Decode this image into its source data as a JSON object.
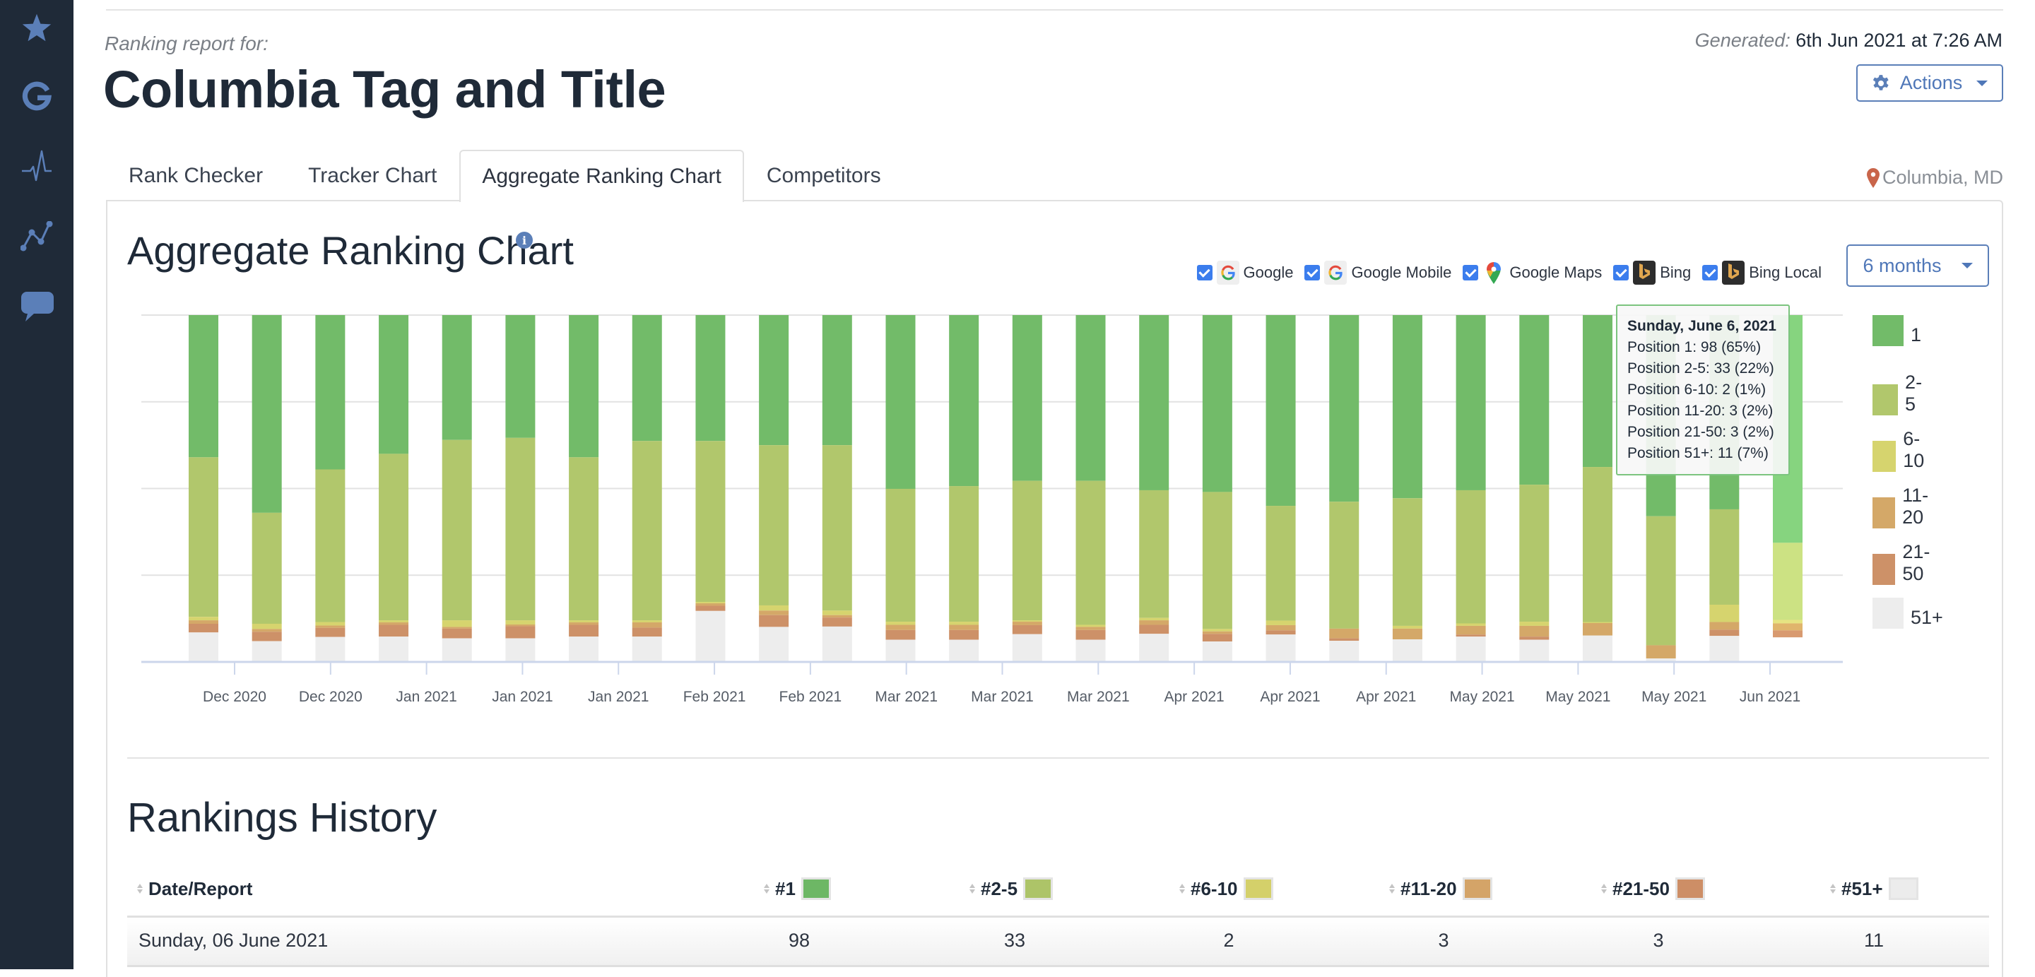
{
  "sidebar": {
    "items": [
      {
        "icon": "star-icon"
      },
      {
        "icon": "google-icon"
      },
      {
        "icon": "pulse-icon"
      },
      {
        "icon": "line-chart-icon"
      },
      {
        "icon": "chat-icon"
      }
    ]
  },
  "header": {
    "report_for": "Ranking report for:",
    "title": "Columbia Tag and Title",
    "generated_label": "Generated:",
    "generated_value": "6th Jun 2021 at 7:26 AM",
    "actions_label": "Actions",
    "location": "Columbia, MD"
  },
  "tabs": [
    {
      "label": "Rank Checker",
      "active": false
    },
    {
      "label": "Tracker Chart",
      "active": false
    },
    {
      "label": "Aggregate Ranking Chart",
      "active": true
    },
    {
      "label": "Competitors",
      "active": false
    }
  ],
  "chart_section": {
    "title": "Aggregate Ranking Chart",
    "filters": [
      {
        "label": "Google",
        "checked": true,
        "icon": "google-icon"
      },
      {
        "label": "Google Mobile",
        "checked": true,
        "icon": "google-icon"
      },
      {
        "label": "Google Maps",
        "checked": true,
        "icon": "google-maps-icon"
      },
      {
        "label": "Bing",
        "checked": true,
        "icon": "bing-icon"
      },
      {
        "label": "Bing Local",
        "checked": true,
        "icon": "bing-icon"
      }
    ],
    "range_label": "6 months"
  },
  "chart_data": {
    "type": "bar",
    "stacked": "percent",
    "title": "Aggregate Ranking Chart",
    "xlabel": "",
    "ylabel": "",
    "ylim": [
      0,
      100
    ],
    "grid": true,
    "legend_position": "right",
    "categories": [
      "",
      "Dec 2020",
      "",
      "Dec 2020",
      "",
      "Jan 2021",
      "",
      "Jan 2021",
      "",
      "Jan 2021",
      "",
      "Feb 2021",
      "",
      "Feb 2021",
      "",
      "Mar 2021",
      "",
      "Mar 2021",
      "",
      "Mar 2021",
      "",
      "Apr 2021",
      "",
      "Apr 2021",
      "",
      "Apr 2021"
    ],
    "tick_labels": [
      "Dec 2020",
      "Dec 2020",
      "Jan 2021",
      "Jan 2021",
      "Jan 2021",
      "Feb 2021",
      "Feb 2021",
      "Mar 2021",
      "Mar 2021",
      "Mar 2021",
      "Apr 2021",
      "Apr 2021",
      "Apr 2021",
      "May 2021",
      "May 2021",
      "May 2021",
      "Jun 2021"
    ],
    "series": [
      {
        "name": "1",
        "color": "#72bb69",
        "values": [
          41,
          57,
          44.5,
          40,
          36,
          35.4,
          41,
          36.3,
          36.3,
          37.5,
          37.5,
          50.1,
          49.3,
          47.8,
          47.8,
          50.5,
          51,
          55,
          53.8,
          52.8,
          50.5,
          48.9,
          43.8,
          58,
          56,
          65
        ]
      },
      {
        "name": "2-5",
        "color": "#b1c76c",
        "values": [
          46,
          32,
          44,
          48,
          52,
          52.6,
          47,
          51.7,
          46.4,
          46.2,
          47.7,
          38.3,
          39.1,
          40.2,
          41.5,
          36.8,
          39.5,
          33.1,
          36.6,
          36.8,
          38.4,
          39.5,
          44.7,
          37.2,
          27.5,
          22
        ]
      },
      {
        "name": "6-10",
        "color": "#d6d46e",
        "values": [
          1,
          1.5,
          1,
          0.6,
          1.9,
          1.2,
          0.6,
          0.6,
          0.4,
          1.5,
          1.3,
          0.9,
          0.9,
          0.4,
          0.6,
          0.7,
          0.7,
          1.3,
          0,
          0.8,
          0.7,
          1.2,
          0.3,
          0,
          5,
          1
        ]
      },
      {
        "name": "11-20",
        "color": "#d4a868",
        "values": [
          1,
          0.8,
          0.7,
          0.7,
          0.5,
          0.5,
          0.7,
          1.5,
          0.7,
          1.3,
          0.7,
          1.5,
          1.5,
          1,
          0.9,
          1.3,
          0.7,
          1.5,
          2.8,
          3.1,
          2.5,
          3.1,
          3.6,
          3.8,
          2.2,
          2
        ]
      },
      {
        "name": "21-50",
        "color": "#cd9168",
        "values": [
          2.5,
          2.7,
          2.6,
          3.4,
          2.8,
          3.5,
          3.4,
          2.6,
          1.5,
          3.4,
          2.6,
          2.8,
          2.8,
          2.6,
          2.8,
          2.6,
          2.2,
          1.2,
          0.7,
          0,
          0.6,
          0.9,
          0,
          0,
          1.8,
          2
        ]
      },
      {
        "name": "51+",
        "color": "#ededed",
        "values": [
          8.5,
          6,
          7.2,
          7.3,
          6.8,
          6.8,
          7.3,
          7.3,
          14.7,
          10.1,
          10.2,
          6.4,
          6.4,
          8,
          6.4,
          8.1,
          5.9,
          7.9,
          6.1,
          6.5,
          7.3,
          6.4,
          7.6,
          1,
          7.5,
          7
        ]
      }
    ],
    "highlighted_index": 25,
    "tooltip": {
      "title": "Sunday, June 6, 2021",
      "lines": [
        "Position 1: 98 (65%)",
        "Position 2-5: 33 (22%)",
        "Position 6-10: 2 (1%)",
        "Position 11-20: 3 (2%)",
        "Position 21-50: 3 (2%)",
        "Position 51+: 11 (7%)"
      ]
    }
  },
  "history": {
    "title": "Rankings History",
    "columns": [
      {
        "label": "Date/Report"
      },
      {
        "label": "#1",
        "color": "#6db765"
      },
      {
        "label": "#2-5",
        "color": "#adc468"
      },
      {
        "label": "#6-10",
        "color": "#d4d06a"
      },
      {
        "label": "#11-20",
        "color": "#d4a468"
      },
      {
        "label": "#21-50",
        "color": "#cd8e66"
      },
      {
        "label": "#51+",
        "color": "#ececec"
      }
    ],
    "rows": [
      [
        "Sunday, 06 June 2021",
        "98",
        "33",
        "2",
        "3",
        "3",
        "11"
      ]
    ]
  }
}
